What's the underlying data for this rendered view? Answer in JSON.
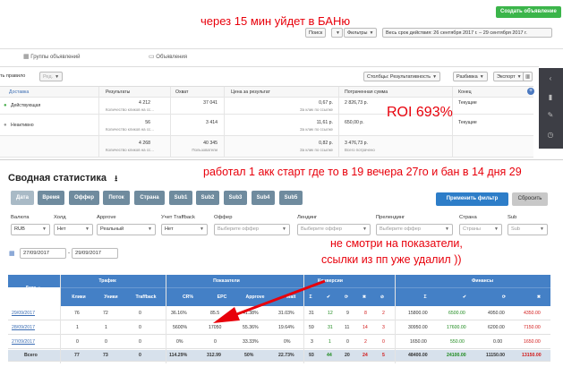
{
  "notes": {
    "top": "через 15 мин уйдет в БАНю",
    "middle": "работал 1 акк старт где то в 19 вечера 27го и бан в 14 дня 29",
    "bottom_line1": "не смотри на показатели,",
    "bottom_line2": "ссылки из пп уже удалил ))",
    "roi": "ROI 693%"
  },
  "fb": {
    "create_button": "Создать объявление",
    "search_label": "Поиск",
    "filters_label": "Фильтры",
    "date_range": "Весь срок действия: 26 сентября 2017 г. – 29 сентября 2017 г.",
    "tab_groups": "Группы объявлений",
    "tab_ads": "Объявления",
    "edit_label": "Ред.",
    "rule_label": "ть правило",
    "columns_label": "Столбцы: Результативность",
    "breakdown_label": "Разбивка",
    "export_label": "Экспорт",
    "headers": [
      "Доставка",
      "Результаты",
      "Охват",
      "Цена за результат",
      "Потраченная сумма",
      "Конец"
    ],
    "rows": [
      {
        "delivery": "Действующая",
        "results": "4 212",
        "results_sub": "Количество кликов на сс...",
        "reach": "37 041",
        "price": "0,67 р.",
        "price_sub": "За клик по ссылке",
        "spent": "2 826,73 р.",
        "end": "Текущие"
      },
      {
        "delivery": "Неактивно",
        "results": "56",
        "results_sub": "Количество кликов на сс...",
        "reach": "3 414",
        "price": "11,61 р.",
        "price_sub": "За клик по ссылке",
        "spent": "650,00 р.",
        "end": "Текущие"
      },
      {
        "delivery": "",
        "results": "4 268",
        "results_sub": "Количество кликов на сс...",
        "reach": "40 345",
        "reach_sub": "Пользователи",
        "price": "0,82 р.",
        "price_sub": "За клик по ссылке",
        "spent": "3 476,73 р.",
        "spent_sub": "Всего потрачено",
        "end": ""
      }
    ]
  },
  "summary": {
    "title": "Сводная статистика",
    "group_buttons": [
      "Дата",
      "Время",
      "Оффер",
      "Поток",
      "Страна",
      "Sub1",
      "Sub2",
      "Sub3",
      "Sub4",
      "Sub5"
    ],
    "apply_button": "Применить фильтр",
    "reset_button": "Сбросить",
    "filters": [
      {
        "label": "Валюта",
        "value": "RUB",
        "placeholder": false
      },
      {
        "label": "Холд",
        "value": "Нет",
        "placeholder": false
      },
      {
        "label": "Approve",
        "value": "Реальный",
        "placeholder": false
      },
      {
        "label": "Учет Traffback",
        "value": "Нет",
        "placeholder": false
      },
      {
        "label": "Оффер",
        "value": "Выберите оффер",
        "placeholder": true
      },
      {
        "label": "Лендинг",
        "value": "Выберите оффер",
        "placeholder": true
      },
      {
        "label": "Прелендинг",
        "value": "Выберите оффер",
        "placeholder": true
      },
      {
        "label": "Страна",
        "value": "Страны",
        "placeholder": true
      },
      {
        "label": "Sub",
        "value": "Sub",
        "placeholder": true
      }
    ],
    "date_from": "27/09/2017",
    "date_to": "29/09/2017"
  },
  "stats": {
    "groups": {
      "traffic": "Трафик",
      "indicators": "Показатели",
      "conversions": "Конверсии",
      "finance": "Финансы"
    },
    "headers": {
      "date": "Дата",
      "clicks": "Клики",
      "uniques": "Уники",
      "traffback": "Traffback",
      "cr": "CR%",
      "epc": "EPC",
      "approve": "Approve",
      "wait": "Wait",
      "sum": "Σ"
    },
    "rows": [
      {
        "date": "29/09/2017",
        "clicks": "76",
        "uniques": "72",
        "traffback": "0",
        "cr": "36.16%",
        "epc": "85.5",
        "approve": "41.38%",
        "wait": "31.03%",
        "c_sum": "31",
        "c_ok": "12",
        "c_wait": "9",
        "c_rej": "8",
        "c_trash": "2",
        "f1": "15800.00",
        "f2": "6500.00",
        "f3": "4950.00",
        "f4": "4350.00"
      },
      {
        "date": "28/09/2017",
        "clicks": "1",
        "uniques": "1",
        "traffback": "0",
        "cr": "5600%",
        "epc": "17050",
        "approve": "55.36%",
        "wait": "19.64%",
        "c_sum": "59",
        "c_ok": "31",
        "c_wait": "11",
        "c_rej": "14",
        "c_trash": "3",
        "f1": "30950.00",
        "f2": "17600.00",
        "f3": "6200.00",
        "f4": "7150.00"
      },
      {
        "date": "27/09/2017",
        "clicks": "0",
        "uniques": "0",
        "traffback": "0",
        "cr": "0%",
        "epc": "0",
        "approve": "33.33%",
        "wait": "0%",
        "c_sum": "3",
        "c_ok": "1",
        "c_wait": "0",
        "c_rej": "2",
        "c_trash": "0",
        "f1": "1650.00",
        "f2": "550.00",
        "f3": "0.00",
        "f4": "1650.00"
      }
    ],
    "total": {
      "date": "Всего",
      "clicks": "77",
      "uniques": "73",
      "traffback": "0",
      "cr": "114.29%",
      "epc": "312.99",
      "approve": "50%",
      "wait": "22.73%",
      "c_sum": "93",
      "c_ok": "44",
      "c_wait": "20",
      "c_rej": "24",
      "c_trash": "5",
      "f1": "48400.00",
      "f2": "24100.00",
      "f3": "11150.00",
      "f4": "13150.00"
    }
  }
}
